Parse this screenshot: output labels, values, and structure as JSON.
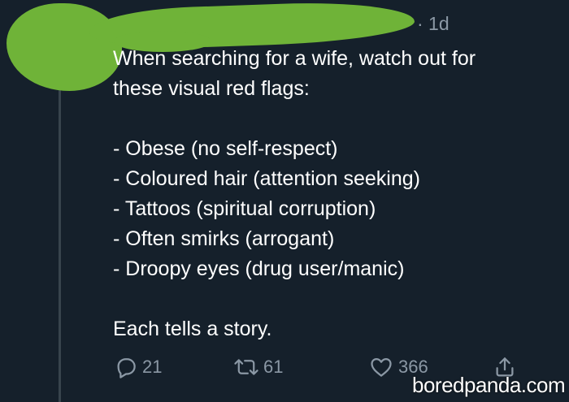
{
  "tweet": {
    "timestamp": "· 1d",
    "lines": {
      "intro_1": "When searching for a wife, watch out for",
      "intro_2": "these visual red flags:",
      "item_1": "- Obese (no self-respect)",
      "item_2": "- Coloured hair (attention seeking)",
      "item_3": "- Tattoos (spiritual corruption)",
      "item_4": "- Often smirks (arrogant)",
      "item_5": "- Droopy eyes (drug user/manic)",
      "closing": "Each tells a story."
    },
    "actions": {
      "replies": "21",
      "retweets": "61",
      "likes": "366"
    }
  },
  "watermark": "boredpanda.com",
  "colors": {
    "background": "#15202b",
    "text": "#ffffff",
    "muted": "#8b98a5",
    "redaction": "#6fb338"
  },
  "icons": [
    "reply-icon",
    "retweet-icon",
    "heart-icon",
    "share-icon"
  ]
}
